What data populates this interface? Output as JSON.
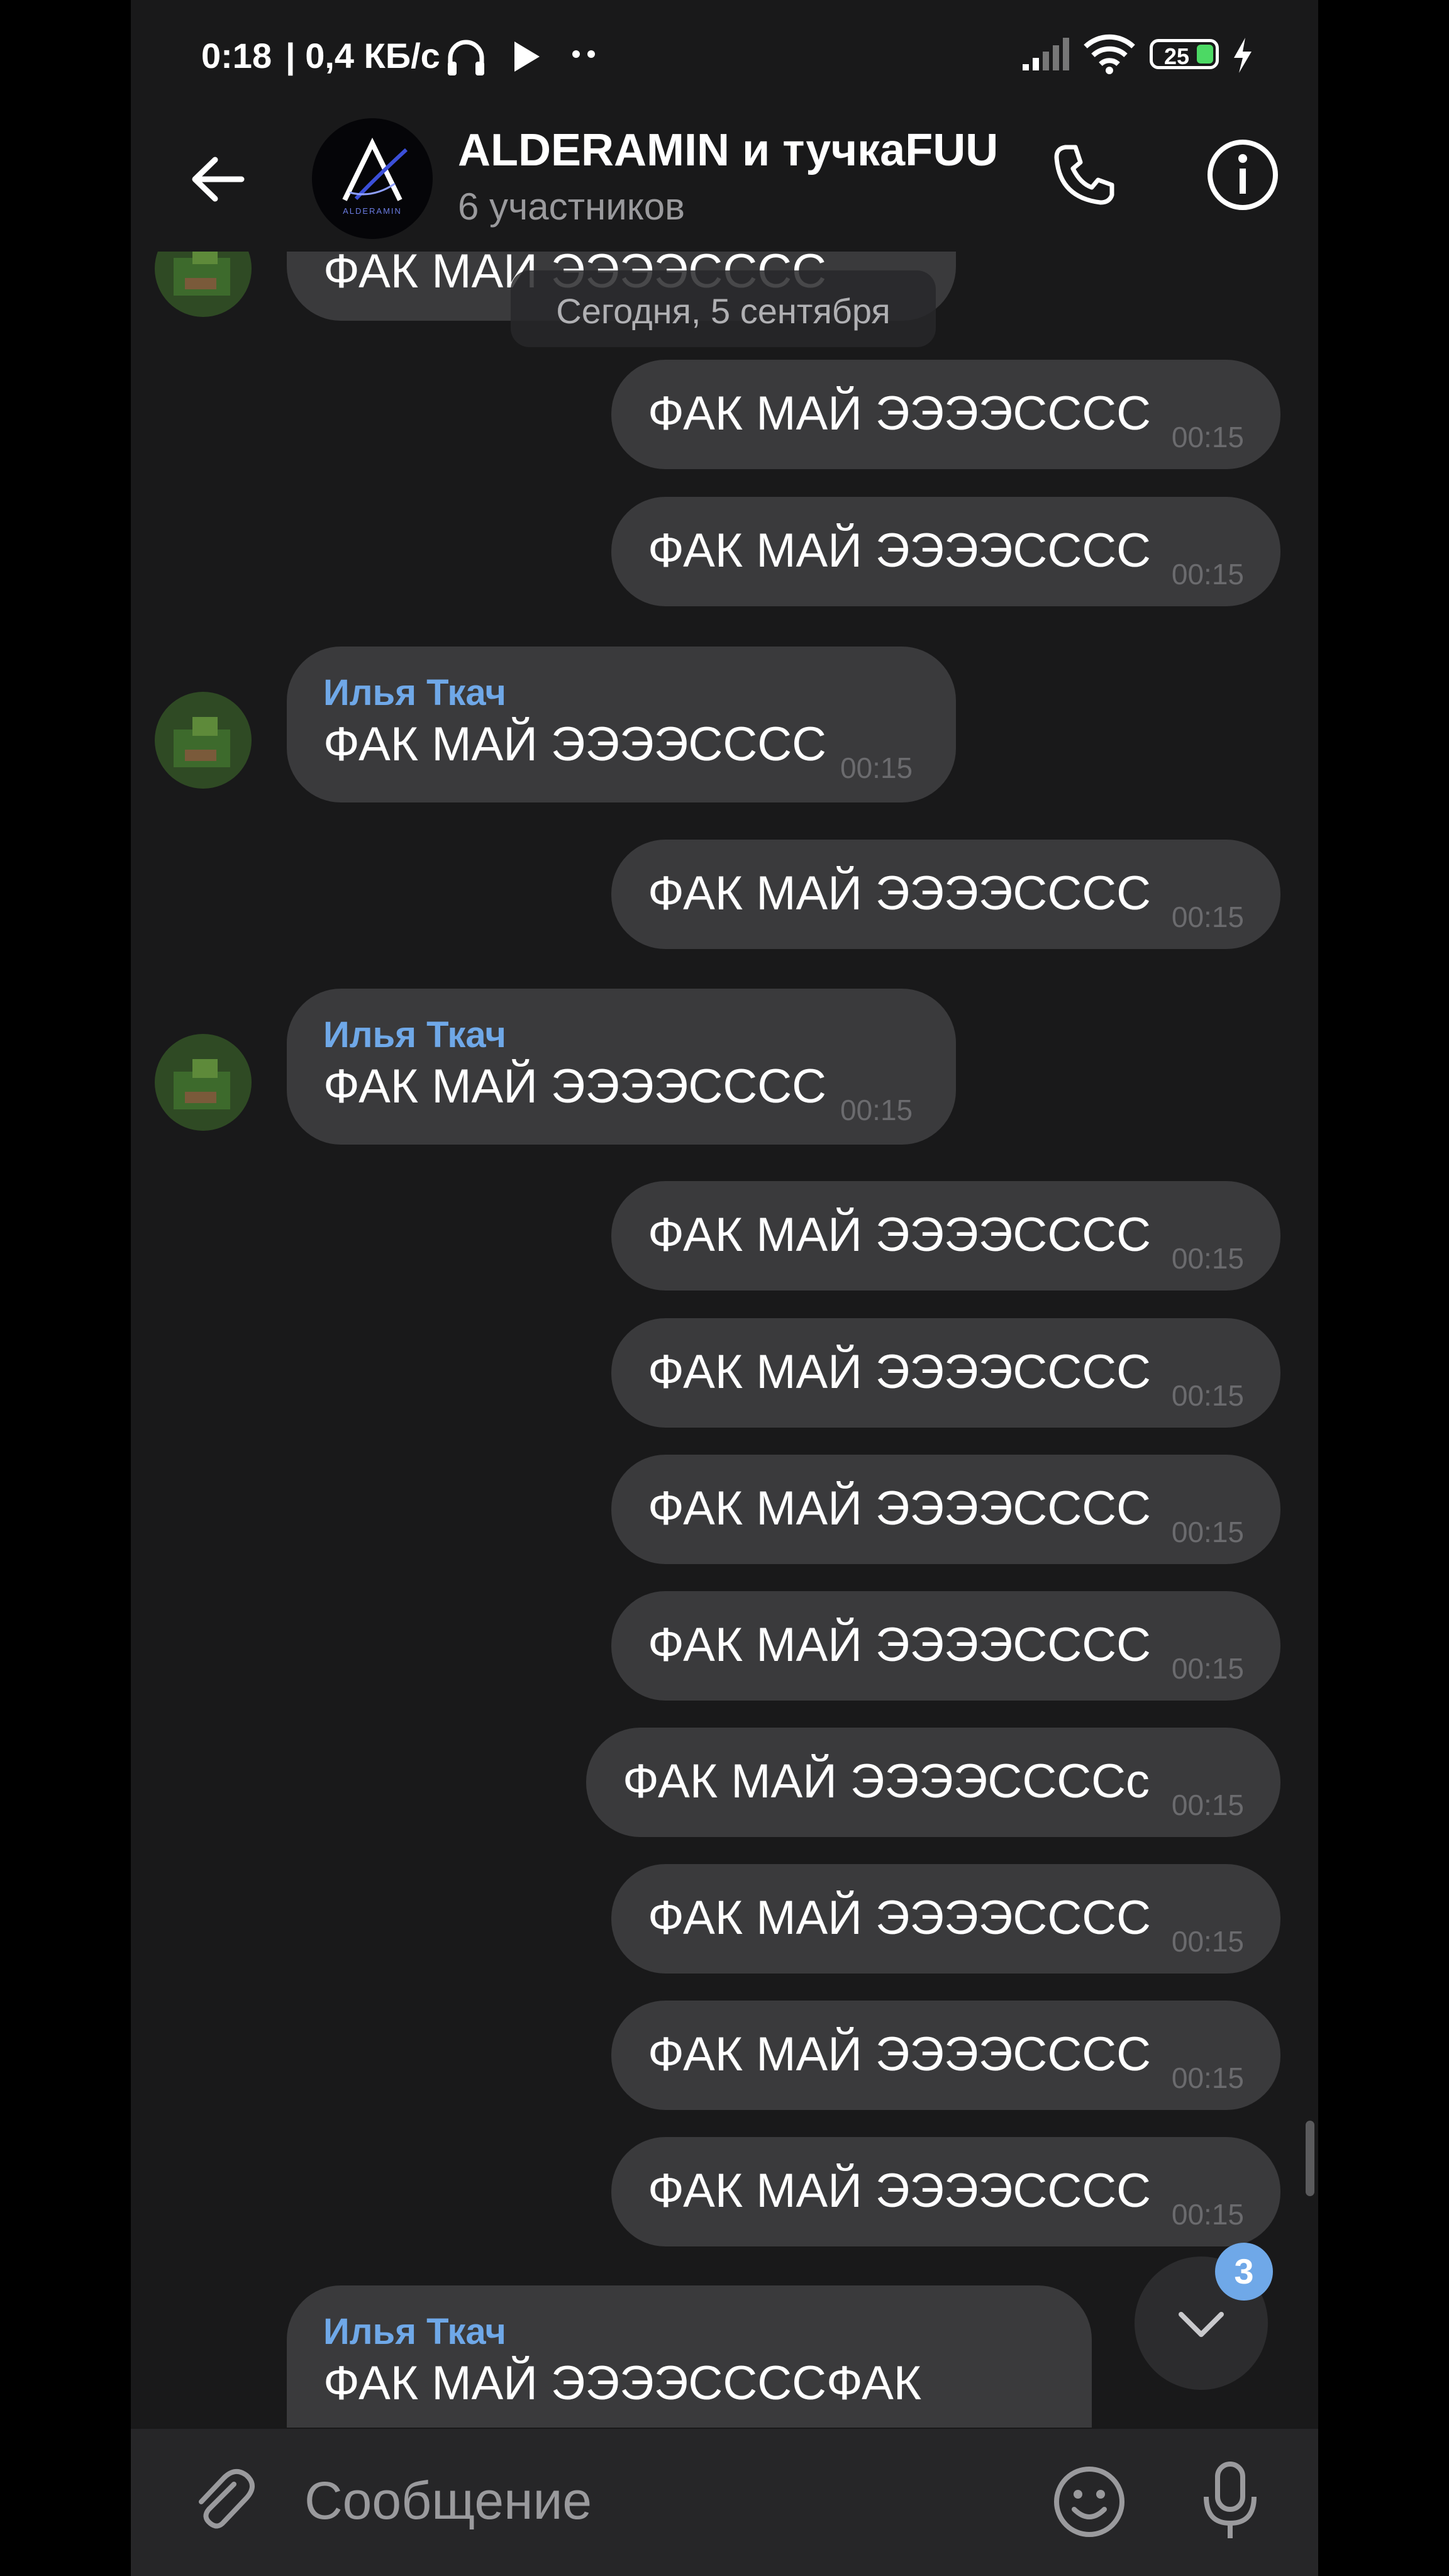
{
  "status_bar": {
    "time": "0:18",
    "speed": "| 0,4 КБ/с",
    "battery": "25"
  },
  "header": {
    "title": "ALDERAMIN и тучкаFUU",
    "subtitle": "6 участников",
    "logo_text": "ALDERAMIN"
  },
  "chat": {
    "top_partial": "ФАК МАЙ ЭЭЭЭСССС",
    "date_separator": "Сегодня, 5 сентября",
    "messages": [
      {
        "direction": "out",
        "text": "ФАК МАЙ ЭЭЭЭСССС",
        "time": "00:15"
      },
      {
        "direction": "out",
        "text": "ФАК МАЙ ЭЭЭЭСССС",
        "time": "00:15"
      },
      {
        "direction": "in",
        "sender": "Илья Ткач",
        "text": "ФАК МАЙ ЭЭЭЭСССС",
        "time": "00:15"
      },
      {
        "direction": "out",
        "text": "ФАК МАЙ ЭЭЭЭСССС",
        "time": "00:15"
      },
      {
        "direction": "in",
        "sender": "Илья Ткач",
        "text": "ФАК МАЙ ЭЭЭЭСССС",
        "time": "00:15"
      },
      {
        "direction": "out",
        "text": "ФАК МАЙ ЭЭЭЭСССС",
        "time": "00:15"
      },
      {
        "direction": "out",
        "text": "ФАК МАЙ ЭЭЭЭСССС",
        "time": "00:15"
      },
      {
        "direction": "out",
        "text": "ФАК МАЙ ЭЭЭЭСССС",
        "time": "00:15"
      },
      {
        "direction": "out",
        "text": "ФАК МАЙ ЭЭЭЭСССС",
        "time": "00:15"
      },
      {
        "direction": "out",
        "text": "ФАК МАЙ ЭЭЭЭССССс",
        "time": "00:15"
      },
      {
        "direction": "out",
        "text": "ФАК МАЙ ЭЭЭЭСССС",
        "time": "00:15"
      },
      {
        "direction": "out",
        "text": "ФАК МАЙ ЭЭЭЭСССС",
        "time": "00:15"
      },
      {
        "direction": "out",
        "text": "ФАК МАЙ ЭЭЭЭСССС",
        "time": "00:15"
      }
    ],
    "last_partial": {
      "sender": "Илья Ткач",
      "text": "ФАК МАЙ ЭЭЭЭССССФАК"
    },
    "unread_count": "3"
  },
  "input": {
    "placeholder": "Сообщение"
  },
  "colors": {
    "background": "#19191a",
    "bubble": "#3a3a3c",
    "accent": "#6fa8e8",
    "input_bar": "#262628"
  },
  "icons": {
    "back": "arrow-left-icon",
    "call": "phone-icon",
    "info": "info-icon",
    "attach": "paperclip-icon",
    "emoji": "emoji-icon",
    "mic": "microphone-icon",
    "scroll_down": "chevron-down-icon"
  }
}
